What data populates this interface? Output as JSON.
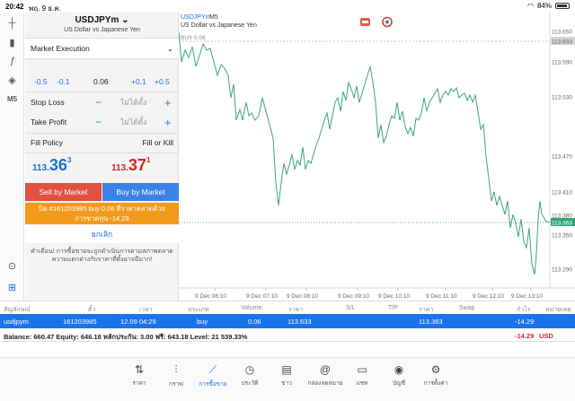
{
  "status": {
    "time": "20:42",
    "date": "พฤ. 9 ธ.ค.",
    "battery": "84%"
  },
  "left_tools": [
    {
      "icon": "crosshair-icon",
      "glyph": "┼"
    },
    {
      "icon": "candles-icon",
      "glyph": "▮"
    },
    {
      "icon": "function-icon",
      "glyph": "ƒ"
    },
    {
      "icon": "shapes-icon",
      "glyph": "◈"
    },
    {
      "icon": "timeframe-label",
      "glyph": "M5"
    },
    {
      "icon": "zoom-icon",
      "glyph": "⊙"
    },
    {
      "icon": "trade-icon",
      "glyph": "⊞"
    }
  ],
  "order": {
    "symbol": "USDJPYm",
    "symbol_desc": "US Dollar vs Japanese Yen",
    "execution": "Market Execution",
    "vol_steps": [
      "-0.5",
      "-0.1",
      "0.06",
      "+0.1",
      "+0.5"
    ],
    "stop_loss": {
      "label": "Stop Loss",
      "value": "ไม่ได้ตั้ง"
    },
    "take_profit": {
      "label": "Take Profit",
      "value": "ไม่ได้ตั้ง"
    },
    "fill_policy": {
      "label": "Fill Policy",
      "value": "Fill or Kill"
    },
    "bid": {
      "main": "113.",
      "big": "36",
      "sup": "3"
    },
    "ask": {
      "main": "113.",
      "big": "37",
      "sup": "1"
    },
    "sell_label": "Sell by Market",
    "buy_label": "Buy by Market",
    "close_line1": "ปิด #161203985 buy 0.06 ที่ราคาตลาดด้วย",
    "close_line2": "การขาดทุน -14.29",
    "cancel_label": "ยกเลิก",
    "warning": "คำเตือน! การซื้อขายจะถูกดำเนินการตามสภาพตลาด ความแตกต่างกับราคาที่ตั้งอาจมีมาก!",
    "colors": {
      "sell": "#e24f43",
      "buy": "#3b82e6",
      "close": "#f29a1a"
    }
  },
  "chart": {
    "symbol": "USDJPYm",
    "timeframe": "M5",
    "desc": "US Dollar vs Japanese Yen",
    "buy_line_label": "BUY 0.06",
    "price_labels": [
      "113.650",
      "113.633",
      "113.590",
      "113.530",
      "113.470",
      "113.410",
      "113.380",
      "113.363",
      "113.350",
      "113.290"
    ],
    "time_labels": [
      "9 Dec 06:10",
      "9 Dec 07:10",
      "9 Dec 08:10",
      "9 Dec 09:10",
      "9 Dec 10:10",
      "9 Dec 11:10",
      "9 Dec 12:10",
      "9 Dec 13:10"
    ],
    "colors": {
      "line": "#3aa57a",
      "buy_line": "#9aa0a6",
      "current": "#2fa874"
    }
  },
  "trade": {
    "headers": [
      "สัญลักษณ์",
      "ตั๋ว",
      "เวลา",
      "ประเภท",
      "Volume",
      "ราคา",
      "S/L",
      "T/P",
      "ราคา",
      "Swap",
      "กำไร",
      "หมายเหตุ"
    ],
    "row": [
      "usdjpym",
      "161203985",
      "12.09 04:29",
      "buy",
      "0.06",
      "113.633",
      "",
      "",
      "113.363",
      "",
      "-14.29",
      ""
    ],
    "balance": "Balance: 660.47 Equity: 646.18 หลักประกัน: 3.00 ฟรี: 643.18 Level: 21 539.33%",
    "balance_profit": "-14.29",
    "currency": "USD"
  },
  "nav": [
    {
      "label": "ราคา",
      "icon": "quotes-icon",
      "glyph": "⇅"
    },
    {
      "label": "กราฟ",
      "icon": "chart-icon",
      "glyph": "⫶"
    },
    {
      "label": "การซื้อขาย",
      "icon": "trade-icon",
      "glyph": "⟋"
    },
    {
      "label": "ประวัติ",
      "icon": "history-icon",
      "glyph": "◷"
    },
    {
      "label": "ข่าว",
      "icon": "news-icon",
      "glyph": "▤"
    },
    {
      "label": "กล่องจดหมาย",
      "icon": "mail-icon",
      "glyph": "@"
    },
    {
      "label": "แชท",
      "icon": "chat-icon",
      "glyph": "▭"
    },
    {
      "label": "บัญชี",
      "icon": "account-icon",
      "glyph": "◉"
    },
    {
      "label": "การตั้งค่า",
      "icon": "settings-icon",
      "glyph": "⚙"
    }
  ]
}
